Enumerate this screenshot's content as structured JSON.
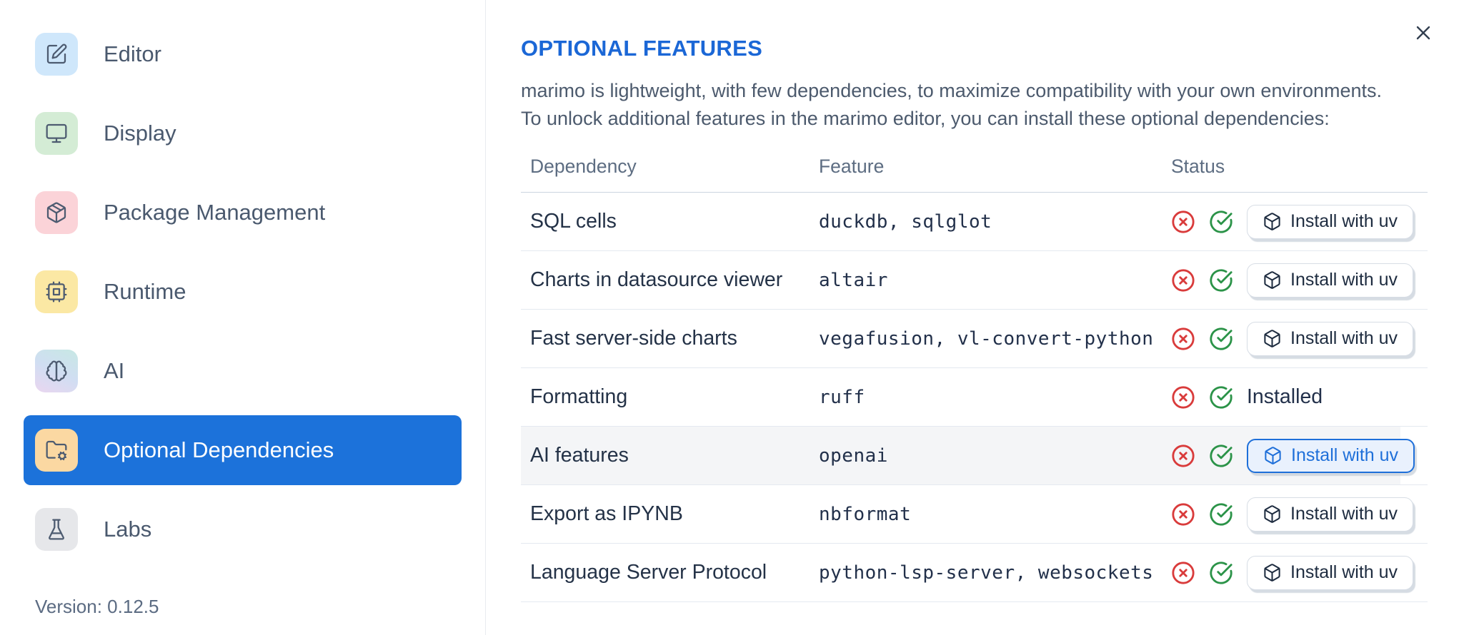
{
  "colors": {
    "accent_blue": "#1c72da",
    "title_blue": "#1b67d6",
    "error_red": "#d93b3b",
    "success_green": "#2b9348"
  },
  "sidebar": {
    "items": [
      {
        "label": "Editor",
        "icon": "square-pen-icon",
        "tile": "#cfe7fb",
        "selected": false
      },
      {
        "label": "Display",
        "icon": "monitor-icon",
        "tile": "#d4ecd5",
        "selected": false
      },
      {
        "label": "Package Management",
        "icon": "package-icon",
        "tile": "#fbd3d8",
        "selected": false
      },
      {
        "label": "Runtime",
        "icon": "cpu-icon",
        "tile": "#fbe8a4",
        "selected": false
      },
      {
        "label": "AI",
        "icon": "brain-icon",
        "tile": "linear-gradient(205deg,#c7e8e4 0%,#d0def2 50%,#ead6f0 100%)",
        "selected": false
      },
      {
        "label": "Optional Dependencies",
        "icon": "folder-cog-icon",
        "tile": "#fbd8a2",
        "selected": true
      },
      {
        "label": "Labs",
        "icon": "flask-icon",
        "tile": "#e6e7ea",
        "selected": false
      }
    ],
    "version": "Version: 0.12.5"
  },
  "dialog": {
    "title": "OPTIONAL FEATURES",
    "description_lines": [
      "marimo is lightweight, with few dependencies, to maximize compatibility with your own environments.",
      "To unlock additional features in the marimo editor, you can install these optional dependencies:"
    ]
  },
  "table": {
    "columns": [
      "Dependency",
      "Feature",
      "Status"
    ],
    "rows": [
      {
        "dependency": "SQL cells",
        "feature": "duckdb, sqlglot",
        "installed": false,
        "action": "Install with uv",
        "highlighted": false,
        "focused": false
      },
      {
        "dependency": "Charts in datasource viewer",
        "feature": "altair",
        "installed": false,
        "action": "Install with uv",
        "highlighted": false,
        "focused": false
      },
      {
        "dependency": "Fast server-side charts",
        "feature": "vegafusion, vl-convert-python",
        "installed": false,
        "action": "Install with uv",
        "highlighted": false,
        "focused": false
      },
      {
        "dependency": "Formatting",
        "feature": "ruff",
        "installed": true,
        "status_label": "Installed",
        "highlighted": false,
        "focused": false
      },
      {
        "dependency": "AI features",
        "feature": "openai",
        "installed": false,
        "action": "Install with uv",
        "highlighted": true,
        "focused": true
      },
      {
        "dependency": "Export as IPYNB",
        "feature": "nbformat",
        "installed": false,
        "action": "Install with uv",
        "highlighted": false,
        "focused": false
      },
      {
        "dependency": "Language Server Protocol",
        "feature": "python-lsp-server, websockets",
        "installed": false,
        "action": "Install with uv",
        "highlighted": false,
        "focused": false
      }
    ]
  }
}
